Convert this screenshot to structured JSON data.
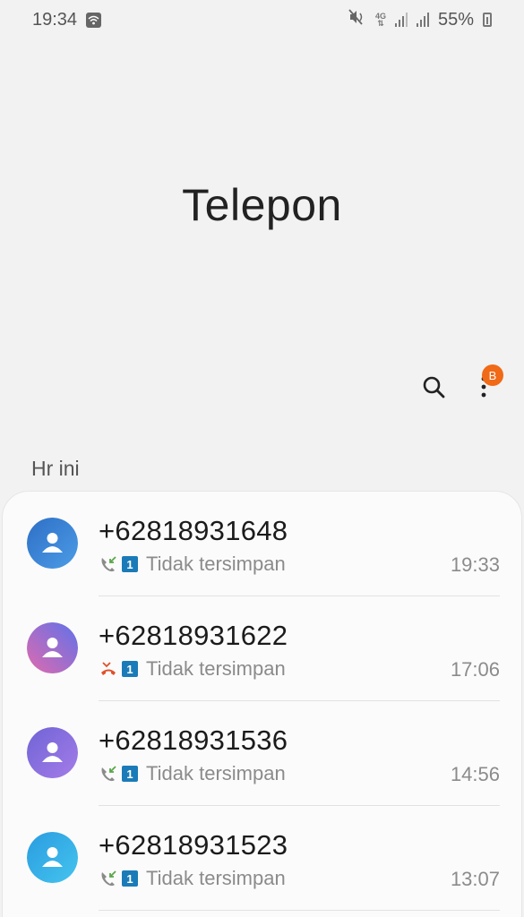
{
  "status_bar": {
    "time": "19:34",
    "network": "4G",
    "battery": "55%"
  },
  "header": {
    "title": "Telepon",
    "badge": "B"
  },
  "section": {
    "label": "Hr ini"
  },
  "calls": [
    {
      "number": "+62818931648",
      "status": "Tidak tersimpan",
      "time": "19:33",
      "type": "incoming",
      "sim": "1",
      "avatar_colors": [
        "#2b6cc4",
        "#4a9ae8"
      ]
    },
    {
      "number": "+62818931622",
      "status": "Tidak tersimpan",
      "time": "17:06",
      "type": "missed",
      "sim": "1",
      "avatar_colors": [
        "#d466b8",
        "#6a6ee8"
      ]
    },
    {
      "number": "+62818931536",
      "status": "Tidak tersimpan",
      "time": "14:56",
      "type": "incoming",
      "sim": "1",
      "avatar_colors": [
        "#7a68d8",
        "#9f7be8"
      ]
    },
    {
      "number": "+62818931523",
      "status": "Tidak tersimpan",
      "time": "13:07",
      "type": "incoming",
      "sim": "1",
      "avatar_colors": [
        "#2aa0e0",
        "#3fc0ee"
      ]
    }
  ],
  "colors": {
    "incoming_icon": "#5aa64a",
    "missed_icon": "#e0502a",
    "sim_badge": "#1b7bb8",
    "badge": "#f06a17"
  }
}
